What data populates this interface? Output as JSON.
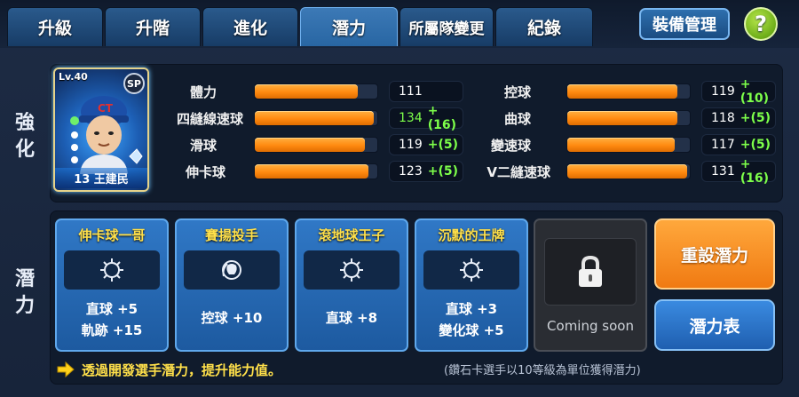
{
  "tabs": [
    {
      "label": "升級",
      "active": false
    },
    {
      "label": "升階",
      "active": false
    },
    {
      "label": "進化",
      "active": false
    },
    {
      "label": "潛力",
      "active": true
    },
    {
      "label": "所屬隊變更",
      "active": false
    },
    {
      "label": "紀錄",
      "active": false
    }
  ],
  "header": {
    "equip_label": "裝備管理",
    "help_label": "?"
  },
  "sections": {
    "enhance_label": "強化",
    "potential_label": "潛力"
  },
  "card": {
    "level": "Lv.40",
    "grade": "SP",
    "team_logo": "CT",
    "player_name": "13 王建民"
  },
  "stats_left": [
    {
      "label": "體力",
      "fill": 0.84,
      "base": "111",
      "bonus": "",
      "highlight": false
    },
    {
      "label": "四縫線速球",
      "fill": 0.97,
      "base": "134",
      "bonus": "+(16)",
      "highlight": true
    },
    {
      "label": "滑球",
      "fill": 0.9,
      "base": "119",
      "bonus": "+(5)",
      "highlight": false
    },
    {
      "label": "伸卡球",
      "fill": 0.93,
      "base": "123",
      "bonus": "+(5)",
      "highlight": false
    }
  ],
  "stats_right": [
    {
      "label": "控球",
      "fill": 0.9,
      "base": "119",
      "bonus": "+(10)",
      "highlight": false
    },
    {
      "label": "曲球",
      "fill": 0.9,
      "base": "118",
      "bonus": "+(5)",
      "highlight": false
    },
    {
      "label": "變速球",
      "fill": 0.88,
      "base": "117",
      "bonus": "+(5)",
      "highlight": false
    },
    {
      "label": "V二縫速球",
      "fill": 0.98,
      "base": "131",
      "bonus": "+(16)",
      "highlight": false
    }
  ],
  "potentials": [
    {
      "title": "伸卡球一哥",
      "icon": "spiky-ball-icon",
      "line1": "直球 +5",
      "line2": "軌跡 +15"
    },
    {
      "title": "賽揚投手",
      "icon": "pitching-hand-icon",
      "line1": "控球 +10",
      "line2": ""
    },
    {
      "title": "滾地球王子",
      "icon": "spiky-ball-icon",
      "line1": "直球 +8",
      "line2": ""
    },
    {
      "title": "沉默的王牌",
      "icon": "spiky-ball-icon",
      "line1": "直球 +3",
      "line2": "變化球 +5"
    }
  ],
  "locked": {
    "label": "Coming soon",
    "icon": "lock-icon"
  },
  "buttons": {
    "reset_label": "重設潛力",
    "table_label": "潛力表"
  },
  "footer": {
    "hint": "透過開發選手潛力，提升能力值。",
    "note": "(鑽石卡選手以10等級為單位獲得潛力)",
    "hint_icon": "arrow-right-icon"
  },
  "colors": {
    "bar_orange": "#ff8a10",
    "bonus_green": "#7dff4a",
    "title_yellow": "#ffe04a",
    "active_tab": "#2866a3"
  }
}
